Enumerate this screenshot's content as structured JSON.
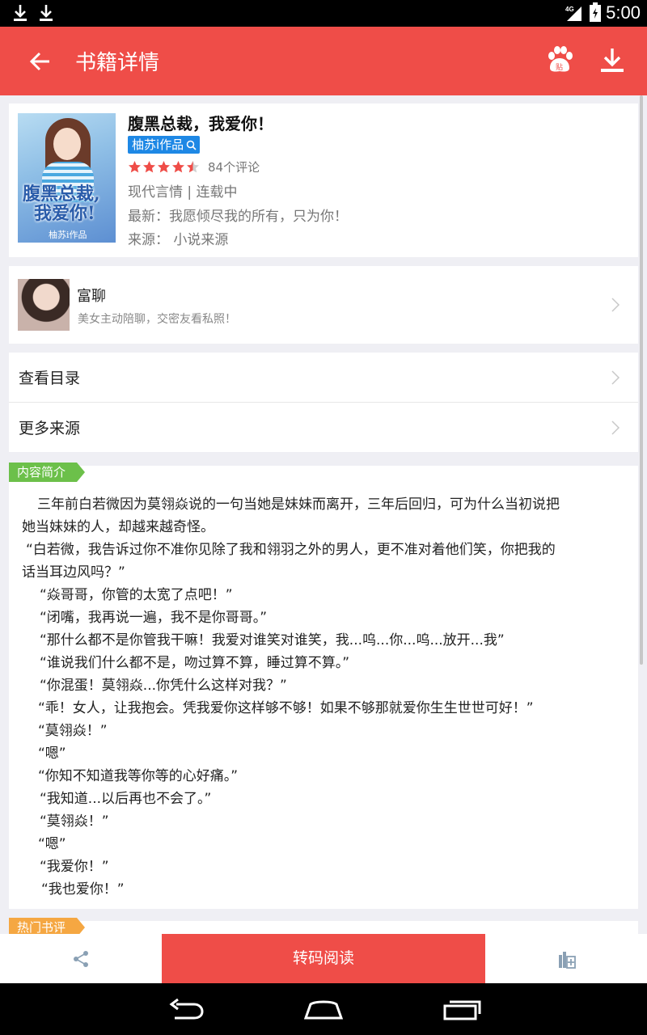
{
  "status_bar": {
    "time": "5:00",
    "network": "4G"
  },
  "app_bar": {
    "title": "书籍详情"
  },
  "book": {
    "title": "腹黑总裁，我爱你！",
    "author": "柚苏i作品",
    "rating": 4.5,
    "rating_max": 5,
    "review_count": "84个评论",
    "category_status": "现代言情 | 连载中",
    "latest": "最新：我愿倾尽我的所有，只为你！",
    "source": "来源： 小说来源",
    "cover": {
      "title_line1": "腹黑总裁,",
      "title_line2": "我爱你!",
      "author": "柚苏i作品"
    }
  },
  "ad": {
    "title": "富聊",
    "subtitle": "美女主动陪聊，交密友看私照！"
  },
  "menu": [
    {
      "label": "查看目录"
    },
    {
      "label": "更多来源"
    }
  ],
  "intro": {
    "tag": "内容简介",
    "lines": [
      "三年前白若微因为莫翎焱说的一句当她是妹妹而离开，三年后回归，可为什么当初说把",
      "她当妹妹的人，却越来越奇怪。",
      "“白若微，我告诉过你不准你见除了我和翎羽之外的男人，更不准对着他们笑，你把我的",
      "话当耳边风吗？”",
      "“焱哥哥，你管的太宽了点吧！”",
      "“闭嘴，我再说一遍，我不是你哥哥。”",
      "“那什么都不是你管我干嘛！我爱对谁笑对谁笑，我...呜...你...呜...放开...我”",
      "“谁说我们什么都不是，吻过算不算，睡过算不算。”",
      "“你混蛋！莫翎焱...你凭什么这样对我？”",
      "“乖！女人，让我抱会。凭我爱你这样够不够！如果不够那就爱你生生世世可好！”",
      "“莫翎焱！”",
      "“嗯”",
      "“你知不知道我等你等的心好痛。”",
      "“我知道...以后再也不会了。”",
      "“莫翎焱！”",
      "“嗯”",
      "“我爱你！”",
      "“我也爱你！”"
    ]
  },
  "hot_reviews": {
    "tag": "热门书评"
  },
  "bottom_bar": {
    "read_label": "转码阅读"
  },
  "icons": {
    "back": "arrow-left-icon",
    "baidu": "paw-icon",
    "download": "download-icon",
    "share": "share-icon",
    "bookshelf": "add-to-shelf-icon"
  },
  "colors": {
    "primary": "#ef4d48",
    "author_badge": "#1e88e5",
    "star": "#ef4d48",
    "intro_tag": "#6cc04a",
    "hot_tag": "#f5a742"
  }
}
